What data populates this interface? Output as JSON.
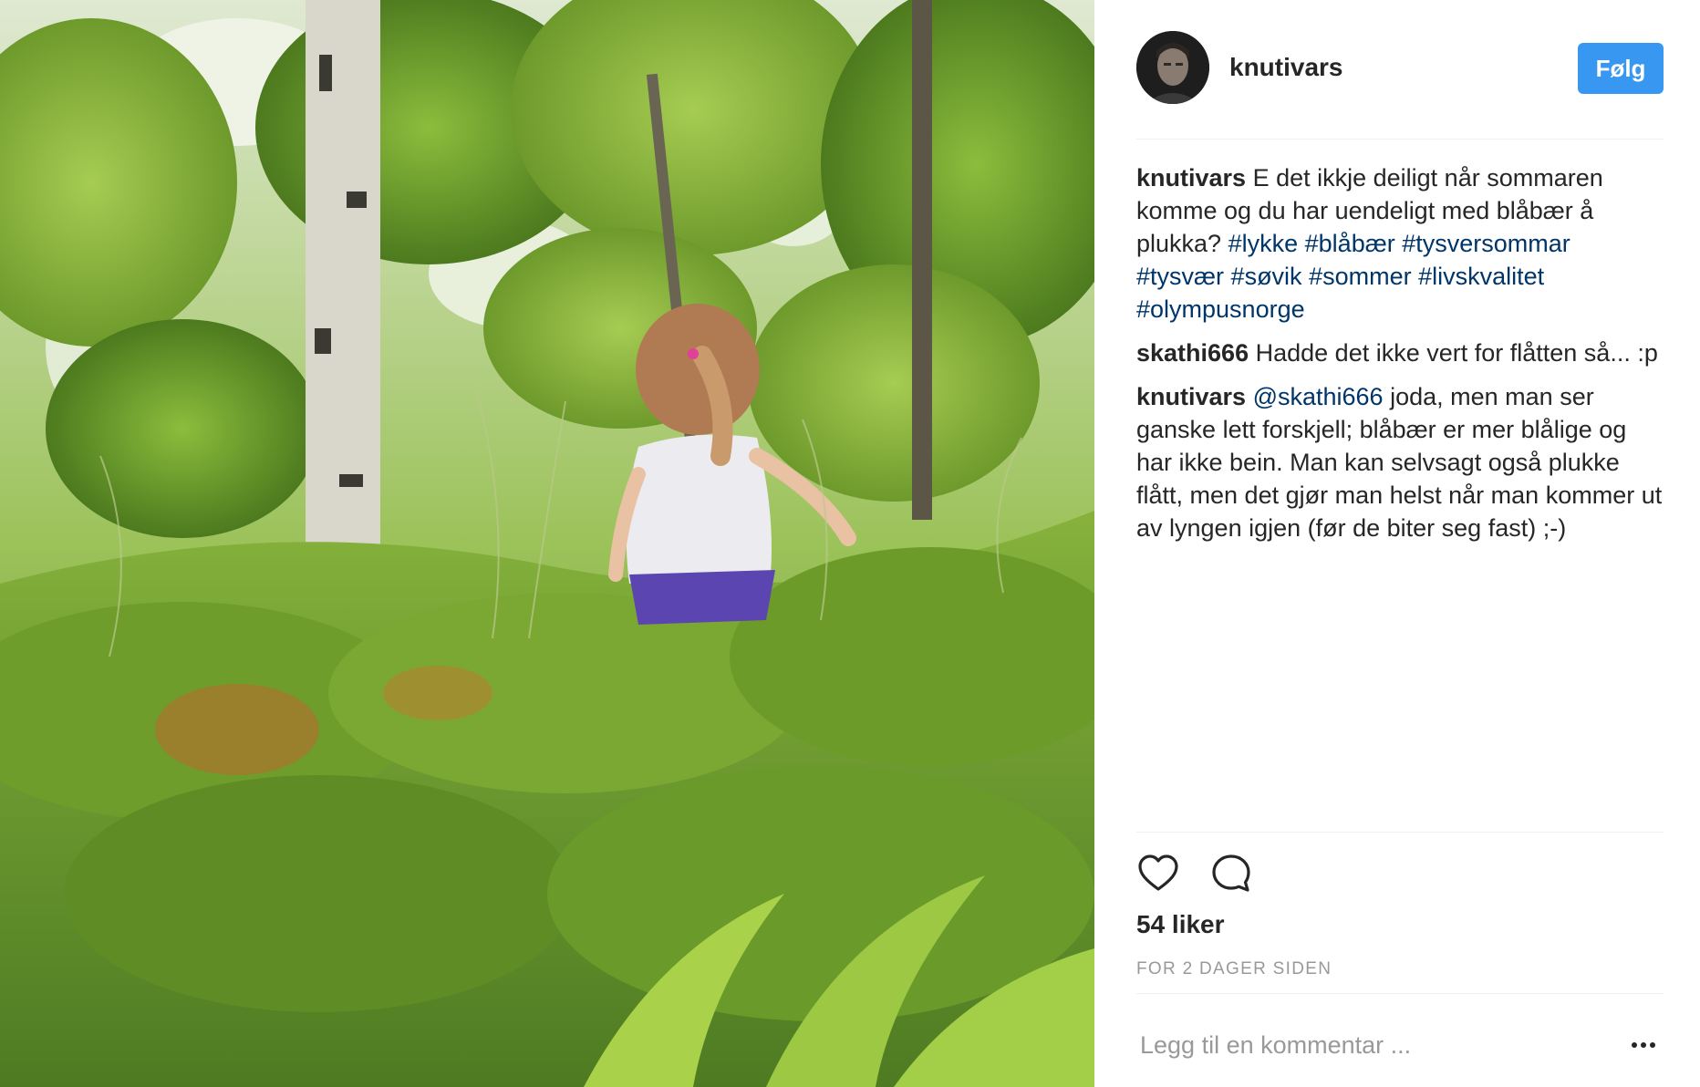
{
  "post": {
    "author": {
      "username": "knutivars",
      "avatar": "avatar-photo"
    },
    "follow_label": "Følg",
    "caption": {
      "author": "knutivars",
      "text": "E det ikkje deiligt når sommaren komme og du har uendeligt med blåbær å plukka?",
      "hashtags": [
        "#lykke",
        "#blåbær",
        "#tysversommar",
        "#tysvær",
        "#søvik",
        "#sommer",
        "#livskvalitet",
        "#olympusnorge"
      ]
    },
    "comments": [
      {
        "author": "skathi666",
        "text": "Hadde det ikke vert for flåtten så... :p"
      },
      {
        "author": "knutivars",
        "mention": "@skathi666",
        "text": "joda, men man ser ganske lett forskjell; blåbær er mer blålige og har ikke bein. Man kan selvsagt også plukke flått, men det gjør man helst når man kommer ut av lyngen igjen (før de biter seg fast) ;-)"
      }
    ],
    "likes": "54 liker",
    "timestamp": "FOR 2 DAGER SIDEN",
    "add_comment_placeholder": "Legg til en kommentar ...",
    "icons": {
      "like": "heart-outline-icon",
      "comment": "speech-bubble-icon",
      "more": "more-dots-icon"
    },
    "colors": {
      "follow_button": "#3897f0",
      "hashtag": "#003569",
      "muted": "#999999"
    }
  }
}
